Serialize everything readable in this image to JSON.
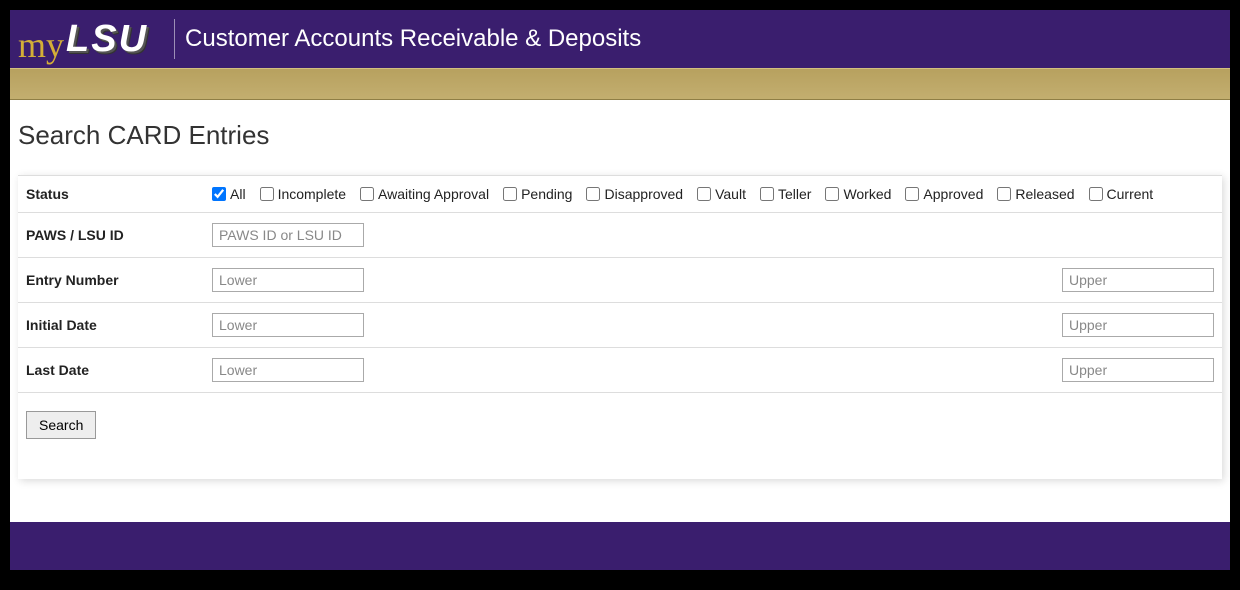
{
  "header": {
    "logo_my": "my",
    "logo_lsu": "LSU",
    "title": "Customer Accounts Receivable & Deposits"
  },
  "page": {
    "title": "Search CARD Entries"
  },
  "form": {
    "status": {
      "label": "Status",
      "options": [
        "All",
        "Incomplete",
        "Awaiting Approval",
        "Pending",
        "Disapproved",
        "Vault",
        "Teller",
        "Worked",
        "Approved",
        "Released",
        "Current"
      ],
      "checked": "All"
    },
    "paws": {
      "label": "PAWS / LSU ID",
      "placeholder": "PAWS ID or LSU ID",
      "value": ""
    },
    "entry": {
      "label": "Entry Number",
      "lower_ph": "Lower",
      "upper_ph": "Upper",
      "lower_val": "",
      "upper_val": ""
    },
    "initial": {
      "label": "Initial Date",
      "lower_ph": "Lower",
      "upper_ph": "Upper",
      "lower_val": "",
      "upper_val": ""
    },
    "last": {
      "label": "Last Date",
      "lower_ph": "Lower",
      "upper_ph": "Upper",
      "lower_val": "",
      "upper_val": ""
    },
    "search_label": "Search"
  }
}
